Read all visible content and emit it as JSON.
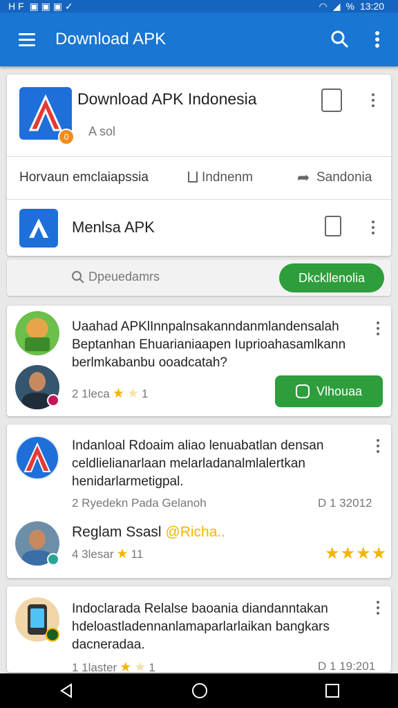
{
  "status": {
    "left": "H F",
    "time": "13:20",
    "battery": "%"
  },
  "appbar": {
    "title": "Download APK"
  },
  "header_card": {
    "app_title": "Download APK Indonesia",
    "subtitle": "A sol",
    "badge": "0",
    "links": [
      "Horvaun emclaiapssia",
      "Indnenm",
      "Sandonia"
    ]
  },
  "app_row": {
    "title": "Menlsa APK"
  },
  "search": {
    "placeholder": "Dpeuedamrs",
    "button": "Dkckllenolia"
  },
  "posts": [
    {
      "text": "Uaahad APKlInnpalnsakanndanmlandensalah Beptanhan Ehuarianiaapen Iuprioahasamlkann berlmkabanbu ooadcatah?",
      "rating": "2 1leca",
      "stars": "1",
      "button": "Vlhouaa"
    },
    {
      "text": "Indanloal Rdoaim aliao lenuabatlan densan celdlielianarlaan melarladanalmlalertkan henidarlarmetigpal.",
      "meta": "2 Ryedekn Pada Gelanoh",
      "date": "D 1 32012",
      "comment_prefix": "Reglam Ssasl",
      "comment_mention": "@Richa..",
      "rating": "4 3lesar",
      "stars": "11"
    },
    {
      "text": "Indoclarada Relalse baoania diandanntakan hdeloastladennanlamaparlarlaikan bangkars dacneradaa.",
      "rating": "1 1laster",
      "stars": "1",
      "date": "D 1 19:201"
    }
  ]
}
